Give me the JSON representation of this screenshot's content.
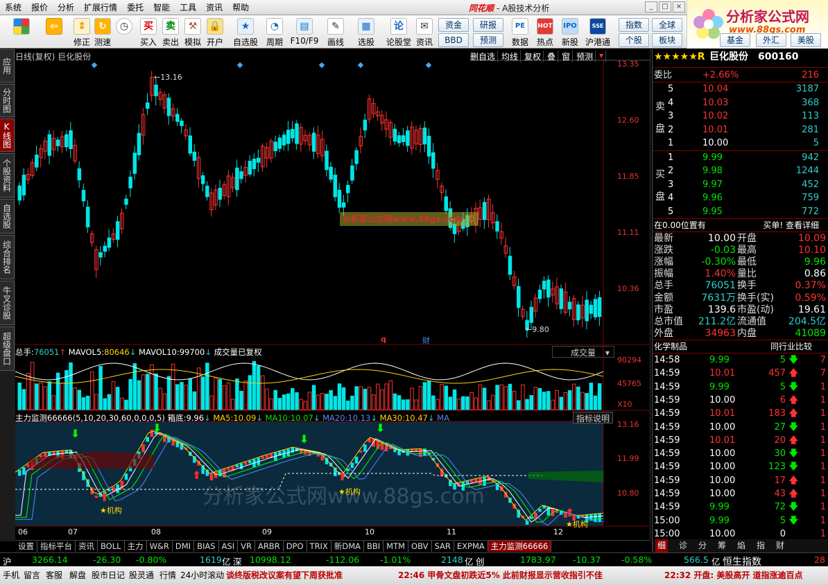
{
  "menu": [
    "系统",
    "报价",
    "分析",
    "扩展行情",
    "委托",
    "智能",
    "工具",
    "资讯",
    "帮助"
  ],
  "app_title": {
    "brand": "同花顺",
    "sub": "- A股技术分析"
  },
  "logo": {
    "title": "分析家公式网",
    "url": "www.88gs.com"
  },
  "toolbar": [
    {
      "label": "",
      "icon": "windows-grid-icon"
    },
    {
      "label": "",
      "icon": "back-arrow-icon"
    },
    {
      "label": "修正",
      "icon": "up-down-arrow-icon"
    },
    {
      "label": "测速",
      "icon": "refresh-icon"
    },
    {
      "label": "",
      "icon": "clock-icon"
    },
    {
      "label": "买入",
      "icon": "buy-icon"
    },
    {
      "label": "卖出",
      "icon": "sell-icon"
    },
    {
      "label": "模拟",
      "icon": "hammer-icon"
    },
    {
      "label": "开户",
      "icon": "lock-icon"
    },
    {
      "label": "自选股",
      "icon": "star-icon"
    },
    {
      "label": "周期",
      "icon": "clock-cycle-icon"
    },
    {
      "label": "F10/F9",
      "icon": "f10-icon"
    },
    {
      "label": "画线",
      "icon": "pencil-icon"
    },
    {
      "label": "选股",
      "icon": "select-stock-icon"
    },
    {
      "label": "论股堂",
      "icon": "forum-icon"
    },
    {
      "label": "资讯",
      "icon": "news-icon"
    },
    {
      "label": "数据",
      "icon": "pe-data-icon"
    },
    {
      "label": "热点",
      "icon": "hot-icon"
    },
    {
      "label": "新股",
      "icon": "ipo-icon"
    },
    {
      "label": "沪港通",
      "icon": "sse-hkex-icon"
    }
  ],
  "toolbar_text_buttons": [
    "资金",
    "BBD",
    "研报",
    "预测",
    "指数",
    "全球",
    "个股",
    "板块",
    "基金",
    "外汇",
    "美股"
  ],
  "left_tabs": [
    "应用",
    "分时图",
    "K线图",
    "个股资料",
    "自选股",
    "综合排名",
    "牛叉诊股",
    "超级盘口"
  ],
  "left_tab_active": 2,
  "chart_header": {
    "period": "日线(复权)",
    "name": "巨化股份"
  },
  "chart_buttons": [
    "删自选",
    "均线",
    "复权",
    "叠",
    "窗",
    "预测"
  ],
  "price_axis": [
    "13.35",
    "12.60",
    "11.85",
    "11.11",
    "10.36"
  ],
  "volume_header": {
    "total_label": "总手:",
    "total": "76051",
    "mavol5_label": "MAVOL5:",
    "mavol5": "80646",
    "mavol10_label": "MAVOL10:",
    "mavol10": "99700",
    "note": "成交量已复权"
  },
  "volume_selector": "成交量",
  "volume_axis": [
    "90294",
    "45765",
    "X10"
  ],
  "indicator_header": {
    "name": "主力监测66666(5,10,20,30,60,0,0,0,5)",
    "box_label": "箱底:",
    "box": "9.96",
    "ma5_label": "MA5:",
    "ma5": "10.09",
    "ma10_label": "MA10:",
    "ma10": "10.07",
    "ma20_label": "MA20:",
    "ma20": "10.13",
    "ma30_label": "MA30:",
    "ma30": "10.47",
    "ma_label": "MA"
  },
  "indicator_btn": "指标说明",
  "indicator_axis": [
    "13.16",
    "11.99",
    "10.80"
  ],
  "annotations": {
    "high": "13.16",
    "low": "9.80",
    "q": "q",
    "fin": "财",
    "watermark_box": "分析家公式网www.88gs.com",
    "watermark_big": "分析家公式网www.88gs.com",
    "jg": "★机构"
  },
  "date_labels": [
    "06",
    "07",
    "08",
    "09",
    "10",
    "11",
    "12"
  ],
  "bottom_tabs": [
    "设置",
    "指标平台",
    "资讯",
    "BOLL",
    "主力",
    "W&R",
    "DMI",
    "BIAS",
    "ASI",
    "VR",
    "ARBR",
    "DPO",
    "TRIX",
    "新DMA",
    "BBI",
    "MTM",
    "OBV",
    "SAR",
    "EXPMA",
    "主力监测66666"
  ],
  "right_small_tabs": [
    "细",
    "诊",
    "分",
    "筹",
    "焰",
    "指",
    "财"
  ],
  "stock": {
    "stars": "★★★★★R",
    "name": "巨化股份",
    "code": "600160"
  },
  "weibi": {
    "label": "委比",
    "pct": "+2.66%",
    "val": "216"
  },
  "sell_label": [
    "卖",
    "盘"
  ],
  "buy_label": [
    "买",
    "盘"
  ],
  "asks": [
    {
      "lvl": "5",
      "price": "10.04",
      "vol": "3187"
    },
    {
      "lvl": "4",
      "price": "10.03",
      "vol": "368"
    },
    {
      "lvl": "3",
      "price": "10.02",
      "vol": "113"
    },
    {
      "lvl": "2",
      "price": "10.01",
      "vol": "281"
    },
    {
      "lvl": "1",
      "price": "10.00",
      "vol": "5"
    }
  ],
  "bids": [
    {
      "lvl": "1",
      "price": "9.99",
      "vol": "942"
    },
    {
      "lvl": "2",
      "price": "9.98",
      "vol": "1244"
    },
    {
      "lvl": "3",
      "price": "9.97",
      "vol": "452"
    },
    {
      "lvl": "4",
      "price": "9.96",
      "vol": "759"
    },
    {
      "lvl": "5",
      "price": "9.95",
      "vol": "772"
    }
  ],
  "order_note": {
    "left": "在0.00位置有",
    "right": "买单! 查看详细"
  },
  "quote": [
    {
      "l1": "最新",
      "v1": "10.00",
      "l2": "开盘",
      "v2": "10.09"
    },
    {
      "l1": "涨跌",
      "v1": "-0.03",
      "l2": "最高",
      "v2": "10.10"
    },
    {
      "l1": "涨幅",
      "v1": "-0.30%",
      "l2": "最低",
      "v2": "9.96"
    },
    {
      "l1": "振幅",
      "v1": "1.40%",
      "l2": "量比",
      "v2": "0.86"
    },
    {
      "l1": "总手",
      "v1": "76051",
      "l2": "换手",
      "v2": "0.37%"
    },
    {
      "l1": "金额",
      "v1": "7631万",
      "l2": "换手(实)",
      "v2": "0.59%"
    },
    {
      "l1": "市盈",
      "v1": "139.6",
      "l2": "市盈(动)",
      "v2": "19.61"
    },
    {
      "l1": "总市值",
      "v1": "211.2亿",
      "l2": "流通值",
      "v2": "204.5亿"
    },
    {
      "l1": "外盘",
      "v1": "34963",
      "l2": "内盘",
      "v2": "41089"
    }
  ],
  "industry": {
    "left": "化学制品",
    "right": "同行业比较"
  },
  "ticks": [
    {
      "t": "14:58",
      "p": "9.99",
      "v": "5",
      "d": "down",
      "x": "7"
    },
    {
      "t": "14:59",
      "p": "10.01",
      "v": "457",
      "d": "up",
      "x": "7"
    },
    {
      "t": "14:59",
      "p": "9.99",
      "v": "5",
      "d": "down",
      "x": "1"
    },
    {
      "t": "14:59",
      "p": "10.00",
      "v": "6",
      "d": "up",
      "x": "1"
    },
    {
      "t": "14:59",
      "p": "10.01",
      "v": "183",
      "d": "up",
      "x": "1"
    },
    {
      "t": "14:59",
      "p": "10.00",
      "v": "27",
      "d": "down",
      "x": "1"
    },
    {
      "t": "14:59",
      "p": "10.01",
      "v": "20",
      "d": "up",
      "x": "1"
    },
    {
      "t": "14:59",
      "p": "10.00",
      "v": "30",
      "d": "down",
      "x": "1"
    },
    {
      "t": "14:59",
      "p": "10.00",
      "v": "123",
      "d": "down",
      "x": "1"
    },
    {
      "t": "14:59",
      "p": "10.00",
      "v": "17",
      "d": "up",
      "x": "1"
    },
    {
      "t": "14:59",
      "p": "10.00",
      "v": "43",
      "d": "up",
      "x": "1"
    },
    {
      "t": "14:59",
      "p": "9.99",
      "v": "72",
      "d": "down",
      "x": "1"
    },
    {
      "t": "15:00",
      "p": "9.99",
      "v": "5",
      "d": "down",
      "x": "1"
    },
    {
      "t": "15:00",
      "p": "10.00",
      "v": "0",
      "d": "",
      "x": "1"
    }
  ],
  "index_bar": {
    "sh": "沪",
    "sh_val": "3266.14",
    "sh_chg": "-26.30",
    "sh_pct": "-0.80%",
    "sh_amt": "1619",
    "sh_unit": "亿",
    "sz": "深",
    "sz_val": "10998.12",
    "sz_chg": "-112.06",
    "sz_pct": "-1.01%",
    "sz_amt": "2148",
    "sz_unit": "亿",
    "cy": "创",
    "cy_val": "1783.97",
    "cy_chg": "-10.37",
    "cy_pct": "-0.58%",
    "hk_amt": "566.5",
    "hk_unit": "亿",
    "hk": "恒生指数",
    "hk_val": "28"
  },
  "status_bar": {
    "items": [
      "手机",
      "留言",
      "客服",
      "解盘",
      "股市日记",
      "股灵通",
      "行情",
      "24小时滚动"
    ],
    "news1": "谈终版税改议案有望下周获批准",
    "news2": "22:46 甲骨文盘初跌近5% 此前财报显示营收指引不佳",
    "news3": "22:32 开盘: 美股高开 道指涨逾百点"
  },
  "colors": {
    "up": "#ff3232",
    "down": "#00e6e6",
    "ma5": "#ffffff",
    "ma10": "#ffd700"
  }
}
